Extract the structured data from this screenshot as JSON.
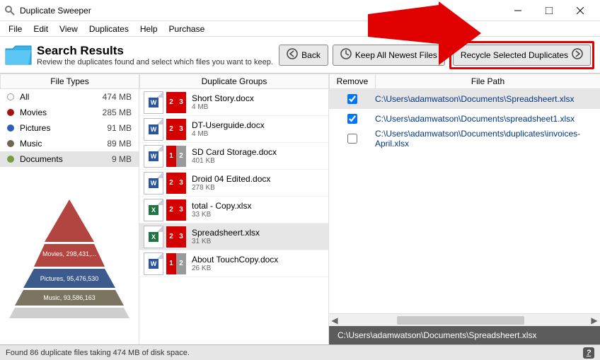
{
  "window": {
    "title": "Duplicate Sweeper"
  },
  "menu": {
    "items": [
      "File",
      "Edit",
      "View",
      "Duplicates",
      "Help",
      "Purchase"
    ]
  },
  "page_header": {
    "title": "Search Results",
    "desc": "Review the duplicates found and select which files you want to keep."
  },
  "buttons": {
    "back": "Back",
    "keep_all": "Keep All Newest Files",
    "recycle": "Recycle Selected Duplicates"
  },
  "columns": {
    "file_types": "File Types",
    "dup_groups": "Duplicate Groups",
    "remove": "Remove",
    "file_path": "File Path"
  },
  "file_types": [
    {
      "name": "All",
      "size": "474 MB",
      "color": "#ffffff",
      "border": "#999"
    },
    {
      "name": "Movies",
      "size": "285 MB",
      "color": "#a51212",
      "border": "#a51212"
    },
    {
      "name": "Pictures",
      "size": "91 MB",
      "color": "#2f5fb5",
      "border": "#2f5fb5"
    },
    {
      "name": "Music",
      "size": "89 MB",
      "color": "#6d6653",
      "border": "#6d6653"
    },
    {
      "name": "Documents",
      "size": "9 MB",
      "color": "#7a9a3d",
      "border": "#7a9a3d",
      "selected": true
    }
  ],
  "pyramid": {
    "movies": "Movies, 298,431,...",
    "pictures": "Pictures, 95,476,530",
    "music": "Music, 93,586,163"
  },
  "groups": [
    {
      "name": "Short Story.docx",
      "size": "4 MB",
      "app": "W",
      "tiles": [
        "2",
        "3"
      ],
      "tcol": [
        "r",
        "r"
      ],
      "selected": false
    },
    {
      "name": "DT-Userguide.docx",
      "size": "4 MB",
      "app": "W",
      "tiles": [
        "2",
        "3"
      ],
      "tcol": [
        "r",
        "r"
      ],
      "selected": false
    },
    {
      "name": "SD Card Storage.docx",
      "size": "401 KB",
      "app": "W",
      "tiles": [
        "1",
        "2"
      ],
      "tcol": [
        "r",
        "g"
      ],
      "selected": false
    },
    {
      "name": "Droid 04 Edited.docx",
      "size": "278 KB",
      "app": "W",
      "tiles": [
        "2",
        "3"
      ],
      "tcol": [
        "r",
        "r"
      ],
      "selected": false
    },
    {
      "name": "total - Copy.xlsx",
      "size": "33 KB",
      "app": "X",
      "tiles": [
        "2",
        "3"
      ],
      "tcol": [
        "r",
        "r"
      ],
      "selected": false
    },
    {
      "name": "Spreadsheert.xlsx",
      "size": "31 KB",
      "app": "X",
      "tiles": [
        "2",
        "3"
      ],
      "tcol": [
        "r",
        "r"
      ],
      "selected": true
    },
    {
      "name": "About TouchCopy.docx",
      "size": "26 KB",
      "app": "W",
      "tiles": [
        "1",
        "2"
      ],
      "tcol": [
        "r",
        "g"
      ],
      "selected": false
    }
  ],
  "file_paths": [
    {
      "checked": true,
      "path": "C:\\Users\\adamwatson\\Documents\\Spreadsheert.xlsx",
      "selected": true
    },
    {
      "checked": true,
      "path": "C:\\Users\\adamwatson\\Documents\\spreadsheet1.xlsx",
      "selected": false
    },
    {
      "checked": false,
      "path": "C:\\Users\\adamwatson\\Documents\\duplicates\\invoices-April.xlsx",
      "selected": false
    }
  ],
  "selected_path": "C:\\Users\\adamwatson\\Documents\\Spreadsheert.xlsx",
  "status": "Found 86 duplicate files taking 474 MB of disk space."
}
